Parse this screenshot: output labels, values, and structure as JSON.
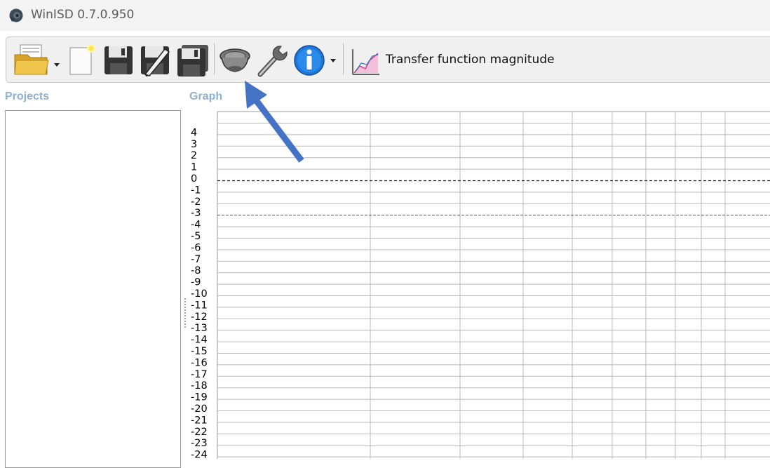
{
  "window": {
    "title": "WinISD 0.7.0.950",
    "icon": "speaker-app-icon"
  },
  "toolbar": {
    "buttons": [
      {
        "name": "open-project-button",
        "icon": "open-folder-icon",
        "has_dropdown": true
      },
      {
        "name": "new-project-button",
        "icon": "new-document-icon"
      },
      {
        "name": "save-button",
        "icon": "floppy-disk-icon"
      },
      {
        "name": "save-as-button",
        "icon": "floppy-pencil-icon"
      },
      {
        "name": "save-all-button",
        "icon": "floppy-disk-stack-icon"
      },
      {
        "name": "driver-editor-button",
        "icon": "speaker-driver-icon"
      },
      {
        "name": "options-button",
        "icon": "wrench-icon"
      },
      {
        "name": "about-button",
        "icon": "info-icon",
        "has_dropdown": true
      }
    ],
    "graph_selector_label": "Transfer function magnitude",
    "graph_selector_icon": "chart-icon"
  },
  "panels": {
    "projects_label": "Projects",
    "graph_label": "Graph"
  },
  "graph": {
    "y_tick_labels": [
      "4",
      "3",
      "2",
      "1",
      "0",
      "-1",
      "-2",
      "-3",
      "-4",
      "-5",
      "-6",
      "-7",
      "-8",
      "-9",
      "-10",
      "-11",
      "-12",
      "-13",
      "-14",
      "-15",
      "-16",
      "-17",
      "-18",
      "-19",
      "-20",
      "-21",
      "-22",
      "-23",
      "-24"
    ],
    "reference_lines": [
      0,
      -3
    ],
    "colors": {
      "grid": "#b9b9b9",
      "reference": "#222222",
      "border": "#9a9a9a"
    }
  },
  "annotation": {
    "color": "#4472c4",
    "points_to": "driver-editor-button"
  }
}
